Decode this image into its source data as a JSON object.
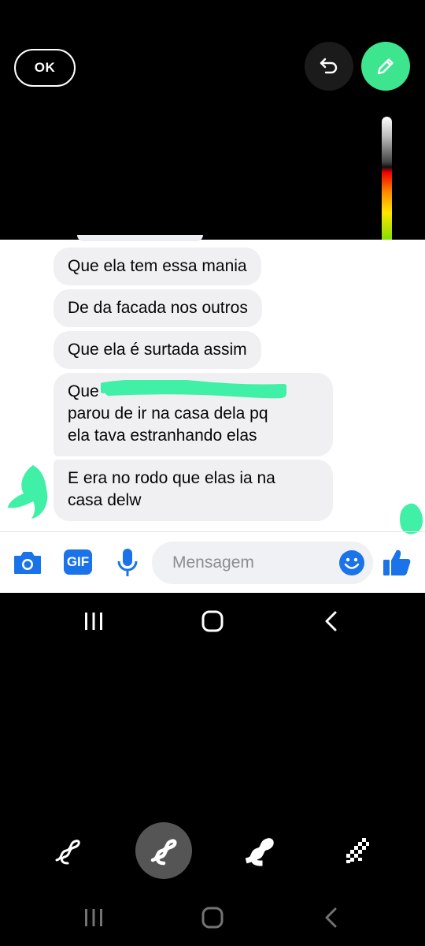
{
  "editor": {
    "ok_label": "OK",
    "undo_icon": "undo-icon",
    "pen_icon": "pen-icon",
    "accent_color": "#3ee58f"
  },
  "messages": [
    {
      "text": "Que ela tem essa mania"
    },
    {
      "text": "De da facada nos outros"
    },
    {
      "text": "Que ela é surtada assim"
    },
    {
      "lines": [
        "Que",
        "parou de ir na casa dela pq",
        "ela tava estranhando elas"
      ]
    },
    {
      "lines": [
        "E era no rodo que elas ia na",
        "casa delw"
      ]
    }
  ],
  "composer": {
    "placeholder": "Mensagem",
    "gif_label": "GIF",
    "icons": [
      "camera-icon",
      "gif-icon",
      "microphone-icon",
      "emoji-icon",
      "thumbs-up-icon"
    ],
    "brand_color": "#1a73e8"
  },
  "navigation": {
    "icons": [
      "recent-apps-icon",
      "home-icon",
      "back-icon"
    ]
  },
  "brushes": {
    "icons": [
      "pen-brush-icon",
      "marker-brush-icon",
      "highlighter-brush-icon",
      "mosaic-brush-icon"
    ],
    "selected_index": 1
  }
}
